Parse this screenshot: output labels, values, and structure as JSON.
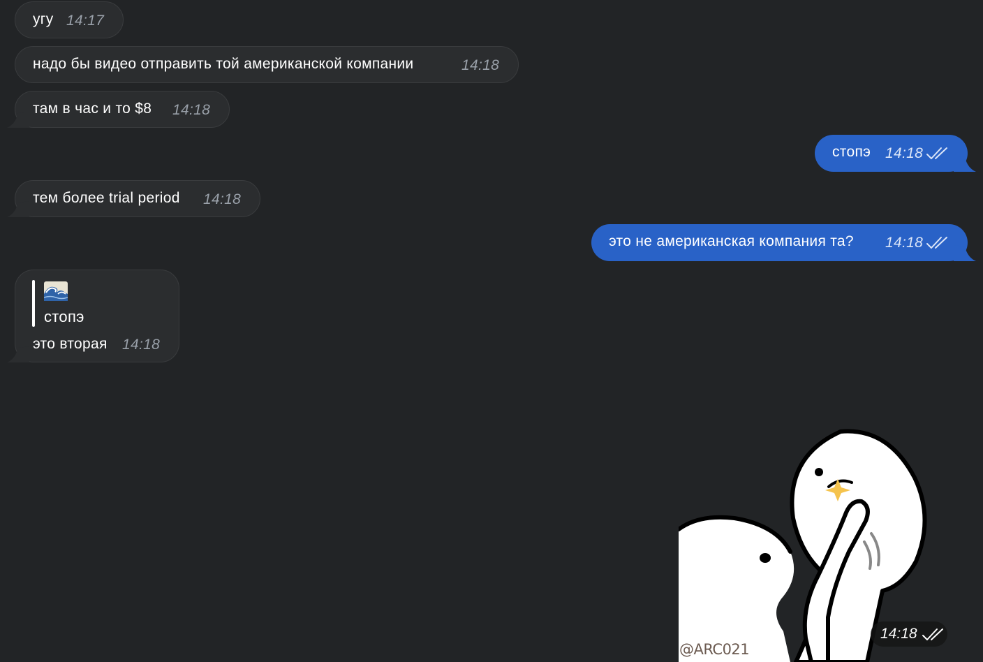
{
  "messages": [
    {
      "direction": "in",
      "text": "угу",
      "time": "14:17"
    },
    {
      "direction": "in",
      "text": "надо бы видео отправить той американской компании",
      "time": "14:18"
    },
    {
      "direction": "in",
      "text": "там в час и то $8",
      "time": "14:18"
    },
    {
      "direction": "out",
      "text": "стопэ",
      "time": "14:18",
      "status": "read"
    },
    {
      "direction": "in",
      "text": "тем более trial period",
      "time": "14:18"
    },
    {
      "direction": "out",
      "text": "это не американская компания та?",
      "time": "14:18",
      "status": "read"
    },
    {
      "direction": "in",
      "reply": {
        "emoji_icon": "wave-emoji",
        "text": "стопэ"
      },
      "text": "это вторая",
      "time": "14:18"
    }
  ],
  "sticker": {
    "signature": "@ARC021",
    "time": "14:18",
    "status": "read"
  },
  "colors": {
    "background": "#222426",
    "incoming_bubble": "#2b2d2f",
    "outgoing_bubble": "#2962c7",
    "timestamp": "#9aa1aa"
  }
}
